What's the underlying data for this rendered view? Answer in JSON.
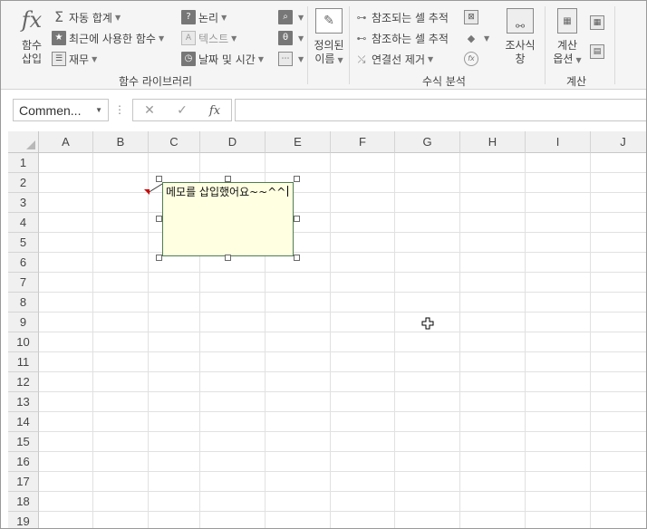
{
  "ribbon": {
    "insert_function": {
      "label_line1": "함수",
      "label_line2": "삽입",
      "icon": "fx-icon"
    },
    "library": {
      "autosum": "자동 합계",
      "recent": "최근에 사용한 함수",
      "financial": "재무",
      "logical": "논리",
      "text": "텍스트",
      "datetime": "날짜 및 시간",
      "group_label": "함수 라이브러리"
    },
    "defined_names": {
      "label_line1": "정의된",
      "label_line2": "이름"
    },
    "auditing": {
      "trace_precedents": "참조되는 셀 추적",
      "trace_dependents": "참조하는 셀 추적",
      "remove_arrows": "연결선 제거",
      "watch_line1": "조사식",
      "watch_line2": "창",
      "group_label": "수식 분석"
    },
    "calculation": {
      "options_line1": "계산",
      "options_line2": "옵션",
      "group_label": "계산"
    }
  },
  "formula_bar": {
    "name_box": "Commen...",
    "cancel": "✕",
    "enter": "✓",
    "fx": "fx",
    "formula": ""
  },
  "grid": {
    "columns": [
      "A",
      "B",
      "C",
      "D",
      "E",
      "F",
      "G",
      "H",
      "I",
      "J"
    ],
    "rows": [
      "1",
      "2",
      "3",
      "4",
      "5",
      "6",
      "7",
      "8",
      "9",
      "10",
      "11",
      "12",
      "13",
      "14",
      "15",
      "16",
      "17",
      "18",
      "19"
    ]
  },
  "comment": {
    "text": "메모를 삽입했어요~~^^",
    "fill": "#ffffe1",
    "border": "#4f7d52",
    "indicator_color": "#cc0000"
  }
}
